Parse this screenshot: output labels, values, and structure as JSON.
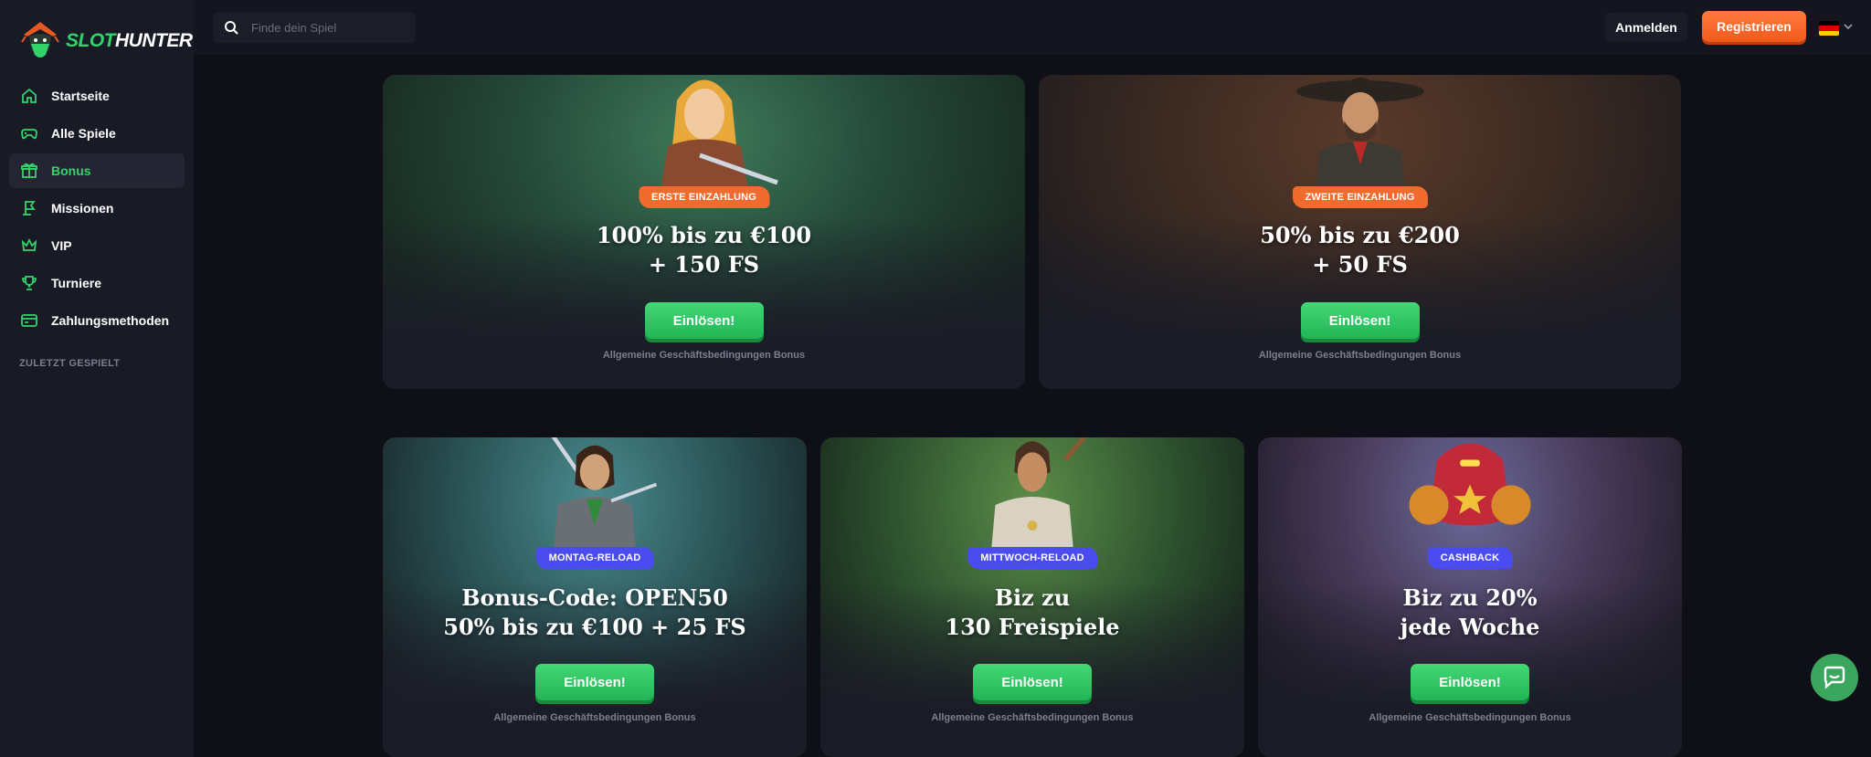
{
  "brand": {
    "name_part1": "SLOT",
    "name_part2": "HUNTER"
  },
  "search": {
    "placeholder": "Finde dein Spiel"
  },
  "header": {
    "login_label": "Anmelden",
    "register_label": "Registrieren"
  },
  "sidebar": {
    "items": [
      {
        "label": "Startseite",
        "icon": "home-icon"
      },
      {
        "label": "Alle Spiele",
        "icon": "gamepad-icon"
      },
      {
        "label": "Bonus",
        "icon": "gift-icon"
      },
      {
        "label": "Missionen",
        "icon": "flag-icon"
      },
      {
        "label": "VIP",
        "icon": "crown-icon"
      },
      {
        "label": "Turniere",
        "icon": "trophy-icon"
      },
      {
        "label": "Zahlungsmethoden",
        "icon": "card-icon"
      }
    ],
    "recent_label": "ZULETZT GESPIELT"
  },
  "cards": [
    {
      "badge": "ERSTE EINZAHLUNG",
      "title_line1": "100% bis zu €100",
      "title_line2": "+ 150 FS",
      "button": "Einlösen!",
      "terms": "Allgemeine Geschäftsbedingungen Bonus"
    },
    {
      "badge": "ZWEITE EINZAHLUNG",
      "title_line1": "50% bis zu €200",
      "title_line2": "+ 50 FS",
      "button": "Einlösen!",
      "terms": "Allgemeine Geschäftsbedingungen Bonus"
    },
    {
      "badge": "MONTAG-RELOAD",
      "title_line1": "Bonus-Code: OPEN50",
      "title_line2": "50% bis zu €100 + 25 FS",
      "button": "Einlösen!",
      "terms": "Allgemeine Geschäftsbedingungen Bonus"
    },
    {
      "badge": "MITTWOCH-RELOAD",
      "title_line1": "Biz zu",
      "title_line2": "130 Freispiele",
      "button": "Einlösen!",
      "terms": "Allgemeine Geschäftsbedingungen Bonus"
    },
    {
      "badge": "CASHBACK",
      "title_line1": "Biz zu 20%",
      "title_line2": "jede Woche",
      "button": "Einlösen!",
      "terms": "Allgemeine Geschäftsbedingungen Bonus"
    }
  ],
  "colors": {
    "accent_green": "#34d36a",
    "accent_orange": "#f26b2e",
    "accent_blue": "#4a4cf0",
    "bg": "#14151f"
  }
}
